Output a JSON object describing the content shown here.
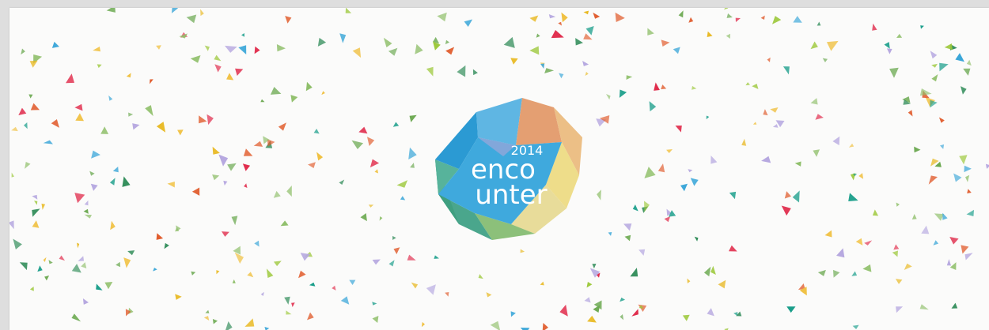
{
  "banner": {
    "background": "#fbfbfa",
    "confetti_colors": [
      "#6aa84f",
      "#2e8b57",
      "#3aa6d8",
      "#e8b820",
      "#e05a2a",
      "#e02a4a",
      "#b6a8e0",
      "#9cc83a",
      "#1a9e8a",
      "#f0c040",
      "#8fbf6a"
    ]
  },
  "logo": {
    "year": "2014",
    "line1": "enco",
    "line2": "unter",
    "colors": {
      "blue": "#3fa9dd",
      "blue_dark": "#2b8fca",
      "orange": "#e39a6a",
      "peach": "#ecbf86",
      "yellow": "#eedd8a",
      "green": "#8cc07a",
      "teal": "#4aa68c",
      "lilac": "#9fa6d8"
    },
    "icon": "gem-icon"
  }
}
